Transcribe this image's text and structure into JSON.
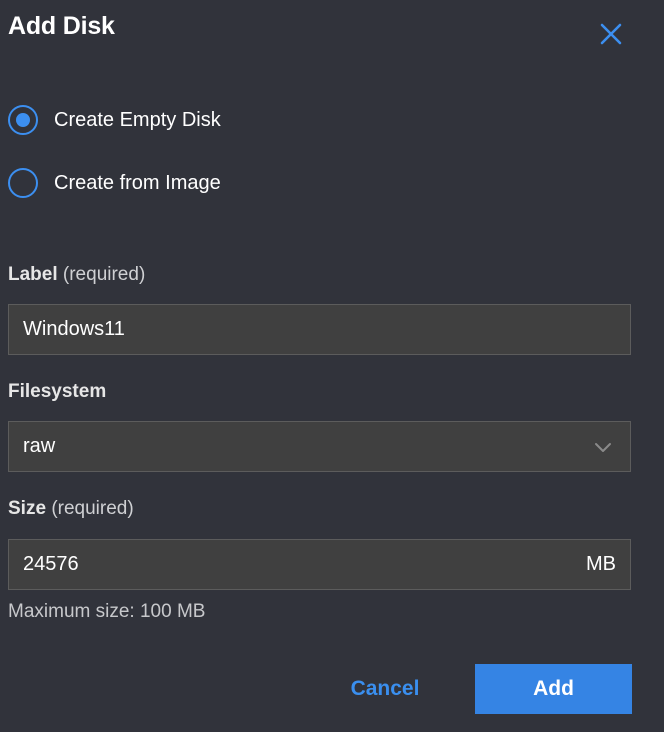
{
  "dialog": {
    "title": "Add Disk",
    "close_icon": "close-icon"
  },
  "source_options": [
    {
      "label": "Create Empty Disk",
      "selected": true
    },
    {
      "label": "Create from Image",
      "selected": false
    }
  ],
  "label_field": {
    "label": "Label",
    "hint": "(required)",
    "value": "Windows11"
  },
  "filesystem_field": {
    "label": "Filesystem",
    "value": "raw",
    "icon": "chevron-down-icon"
  },
  "size_field": {
    "label": "Size",
    "hint": "(required)",
    "value": "24576",
    "unit": "MB",
    "help": "Maximum size: 100 MB"
  },
  "actions": {
    "cancel_label": "Cancel",
    "add_label": "Add"
  },
  "colors": {
    "background": "#31333b",
    "accent": "#3584e4",
    "input_bg": "#404040"
  }
}
